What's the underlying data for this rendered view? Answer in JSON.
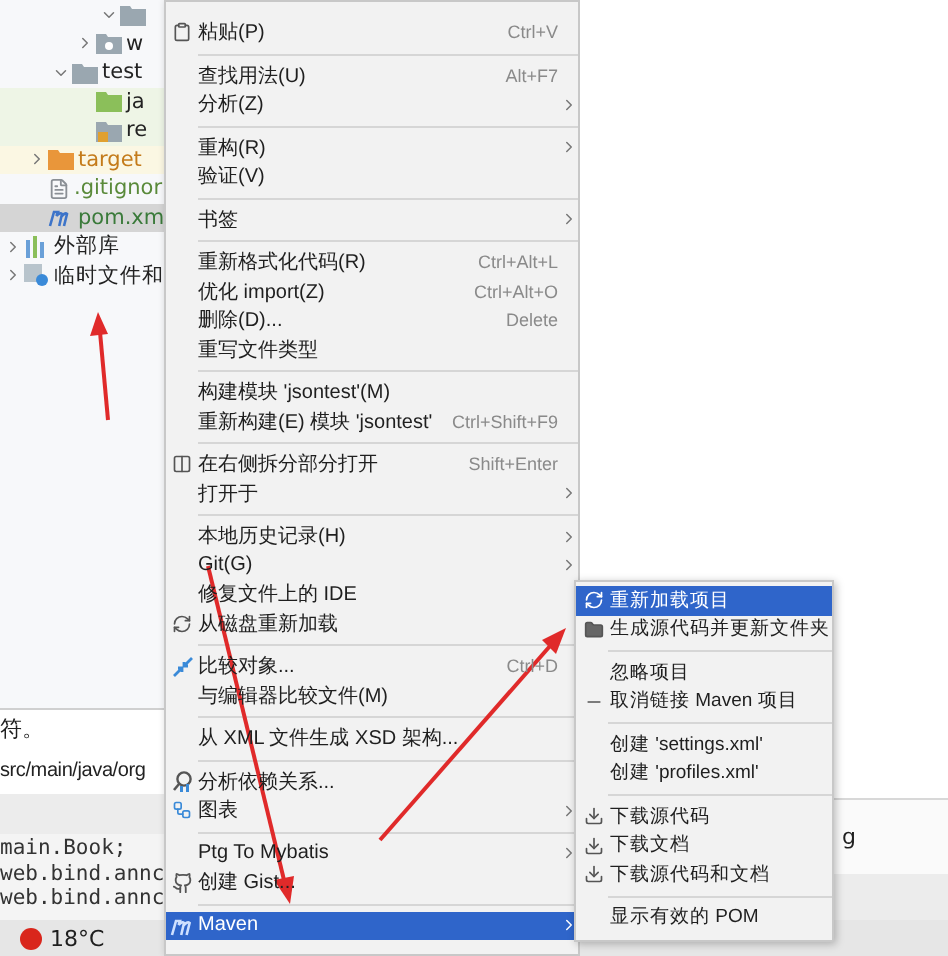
{
  "project_tree": [
    {
      "children": [
        {
          "children": [
            {
              "children": [
                {
                  "children": [
                    {
                      "kind": "folder",
                      "expanded": true,
                      "selected": false
                    }
                  ]
                },
                {
                  "kind": "package",
                  "label": "w",
                  "expanded": false,
                  "selected": false
                }
              ]
            },
            {
              "kind": "folder",
              "label": "test",
              "expanded": true,
              "selected": false,
              "children": [
                {
                  "kind": "source",
                  "label": "ja",
                  "selected": false
                },
                {
                  "kind": "resources",
                  "label": "re",
                  "selected": false
                }
              ]
            }
          ]
        },
        {
          "kind": "excluded",
          "label": "target",
          "expanded": false,
          "selected": false
        },
        {
          "kind": "file",
          "label": ".gitignor",
          "selected": false
        },
        {
          "kind": "maven",
          "label": "pom.xm",
          "selected": true
        }
      ]
    },
    {
      "kind": "library",
      "label": "外部库",
      "expanded": false,
      "selected": false
    },
    {
      "kind": "scratch",
      "label": "临时文件和",
      "expanded": false,
      "selected": false
    }
  ],
  "bottom_panel": {
    "message": "符。",
    "path": "src/main/java/org",
    "code_lines": [
      "main.Book;",
      "web.bind.annc",
      "web.bind.annc"
    ],
    "path_tail": "g"
  },
  "status_bar": {
    "weather": "18°C"
  },
  "context_menu": [
    {
      "kind": "item",
      "label": "粘贴(P)",
      "shortcut": "Ctrl+V",
      "selected": false,
      "submenu": false
    },
    {
      "kind": "separator"
    },
    {
      "kind": "item",
      "label": "查找用法(U)",
      "shortcut": "Alt+F7",
      "selected": false,
      "submenu": false
    },
    {
      "kind": "item",
      "label": "分析(Z)",
      "selected": false,
      "submenu": true
    },
    {
      "kind": "separator"
    },
    {
      "kind": "item",
      "label": "重构(R)",
      "selected": false,
      "submenu": true
    },
    {
      "kind": "item",
      "label": "验证(V)",
      "selected": false,
      "submenu": false
    },
    {
      "kind": "separator"
    },
    {
      "kind": "item",
      "label": "书签",
      "selected": false,
      "submenu": true
    },
    {
      "kind": "separator"
    },
    {
      "kind": "item",
      "label": "重新格式化代码(R)",
      "shortcut": "Ctrl+Alt+L",
      "selected": false,
      "submenu": false
    },
    {
      "kind": "item",
      "label": "优化 import(Z)",
      "shortcut": "Ctrl+Alt+O",
      "selected": false,
      "submenu": false
    },
    {
      "kind": "item",
      "label": "删除(D)...",
      "shortcut": "Delete",
      "selected": false,
      "submenu": false
    },
    {
      "kind": "item",
      "label": "重写文件类型",
      "selected": false,
      "submenu": false
    },
    {
      "kind": "separator"
    },
    {
      "kind": "item",
      "label": "构建模块 'jsontest'(M)",
      "selected": false,
      "submenu": false
    },
    {
      "kind": "item",
      "label": "重新构建(E) 模块 'jsontest'",
      "shortcut": "Ctrl+Shift+F9",
      "selected": false,
      "submenu": false
    },
    {
      "kind": "separator"
    },
    {
      "kind": "item",
      "label": "在右侧拆分部分打开",
      "shortcut": "Shift+Enter",
      "selected": false,
      "submenu": false
    },
    {
      "kind": "item",
      "label": "打开于",
      "selected": false,
      "submenu": true
    },
    {
      "kind": "separator"
    },
    {
      "kind": "item",
      "label": "本地历史记录(H)",
      "selected": false,
      "submenu": true
    },
    {
      "kind": "item",
      "label": "Git(G)",
      "selected": false,
      "submenu": true
    },
    {
      "kind": "item",
      "label": "修复文件上的 IDE",
      "selected": false,
      "submenu": false
    },
    {
      "kind": "item",
      "label": "从磁盘重新加载",
      "selected": false,
      "submenu": false
    },
    {
      "kind": "separator"
    },
    {
      "kind": "item",
      "label": "比较对象...",
      "shortcut": "Ctrl+D",
      "selected": false,
      "submenu": false
    },
    {
      "kind": "item",
      "label": "与编辑器比较文件(M)",
      "selected": false,
      "submenu": false
    },
    {
      "kind": "separator"
    },
    {
      "kind": "item",
      "label": "从 XML 文件生成 XSD 架构...",
      "selected": false,
      "submenu": false
    },
    {
      "kind": "separator"
    },
    {
      "kind": "item",
      "label": "分析依赖关系...",
      "selected": false,
      "submenu": false
    },
    {
      "kind": "item",
      "label": "图表",
      "selected": false,
      "submenu": true
    },
    {
      "kind": "separator"
    },
    {
      "kind": "item",
      "label": "Ptg To Mybatis",
      "selected": false,
      "submenu": true
    },
    {
      "kind": "item",
      "label": "创建 Gist...",
      "selected": false,
      "submenu": false
    },
    {
      "kind": "separator"
    },
    {
      "kind": "item",
      "label": "Maven",
      "selected": true,
      "submenu": true
    }
  ],
  "maven_submenu": [
    {
      "kind": "item",
      "label": "重新加载项目",
      "selected": true
    },
    {
      "kind": "item",
      "label": "生成源代码并更新文件夹",
      "selected": false
    },
    {
      "kind": "separator"
    },
    {
      "kind": "item",
      "label": "忽略项目",
      "selected": false
    },
    {
      "kind": "item",
      "label": "取消链接 Maven 项目",
      "selected": false
    },
    {
      "kind": "separator"
    },
    {
      "kind": "item",
      "label": "创建 'settings.xml'",
      "selected": false
    },
    {
      "kind": "item",
      "label": "创建 'profiles.xml'",
      "selected": false
    },
    {
      "kind": "separator"
    },
    {
      "kind": "item",
      "label": "下载源代码",
      "selected": false
    },
    {
      "kind": "item",
      "label": "下载文档",
      "selected": false
    },
    {
      "kind": "item",
      "label": "下载源代码和文档",
      "selected": false
    },
    {
      "kind": "separator"
    },
    {
      "kind": "item",
      "label": "显示有效的 POM",
      "selected": false
    }
  ]
}
